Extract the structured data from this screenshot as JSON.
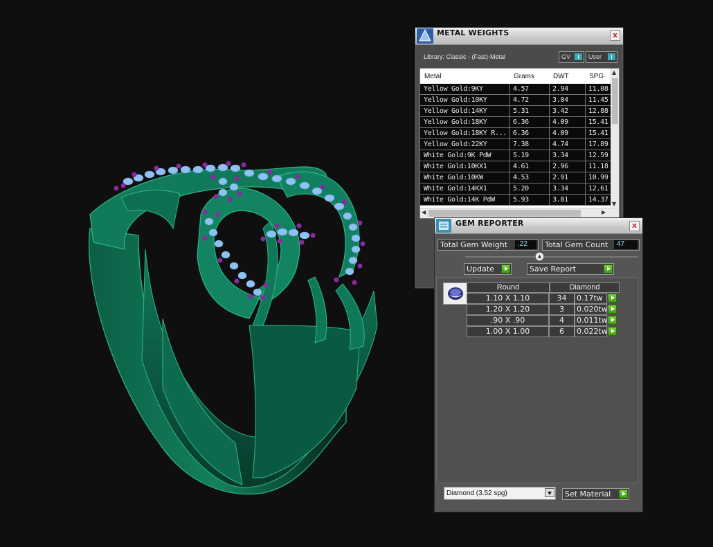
{
  "metal_weights": {
    "title": "METAL WEIGHTS",
    "library": "Library: Classic - (Fast)-Metal",
    "toggle_gv": "GV",
    "toggle_user": "User",
    "close": "x",
    "columns": [
      "Metal",
      "Grams",
      "DWT",
      "SPG"
    ],
    "rows": [
      {
        "metal": "Yellow Gold:9KY",
        "grams": "4.57",
        "dwt": "2.94",
        "spg": "11.08"
      },
      {
        "metal": "Yellow Gold:10KY",
        "grams": "4.72",
        "dwt": "3.04",
        "spg": "11.45"
      },
      {
        "metal": "Yellow Gold:14KY",
        "grams": "5.31",
        "dwt": "3.42",
        "spg": "12.88"
      },
      {
        "metal": "Yellow Gold:18KY",
        "grams": "6.36",
        "dwt": "4.09",
        "spg": "15.41"
      },
      {
        "metal": "Yellow Gold:18KY R...",
        "grams": "6.36",
        "dwt": "4.09",
        "spg": "15.41"
      },
      {
        "metal": "Yellow Gold:22KY",
        "grams": "7.38",
        "dwt": "4.74",
        "spg": "17.89"
      },
      {
        "metal": "White Gold:9K PdW",
        "grams": "5.19",
        "dwt": "3.34",
        "spg": "12.59"
      },
      {
        "metal": "White Gold:10KX1",
        "grams": "4.61",
        "dwt": "2.96",
        "spg": "11.18"
      },
      {
        "metal": "White Gold:10KW",
        "grams": "4.53",
        "dwt": "2.91",
        "spg": "10.99"
      },
      {
        "metal": "White Gold:14KX1",
        "grams": "5.20",
        "dwt": "3.34",
        "spg": "12.61"
      },
      {
        "metal": "White Gold:14K PdW",
        "grams": "5.93",
        "dwt": "3.81",
        "spg": "14.37"
      }
    ]
  },
  "gem_reporter": {
    "title": "GEM REPORTER",
    "close": "x",
    "total_weight_label": "Total Gem Weight",
    "total_weight_value": ".22",
    "total_count_label": "Total Gem Count",
    "total_count_value": "47",
    "update_label": "Update",
    "save_report_label": "Save Report",
    "header_shape": "Round",
    "header_material": "Diamond",
    "rows": [
      {
        "size": "1.10 X 1.10",
        "count": "34",
        "tw": "0.17tw"
      },
      {
        "size": "1.20 X 1.20",
        "count": "3",
        "tw": "0.020tw"
      },
      {
        "size": ".90 X .90",
        "count": "4",
        "tw": "0.011tw"
      },
      {
        "size": "1.00 X 1.00",
        "count": "6",
        "tw": "0.022tw"
      }
    ],
    "material_select": "Diamond     (3.52 spg)",
    "set_material_label": "Set Material"
  },
  "colors": {
    "ring_green": "#0f6e52",
    "gem_blue": "#8fc2f0",
    "prong_purple": "#8a2aa0",
    "go_green": "#5bb725"
  }
}
